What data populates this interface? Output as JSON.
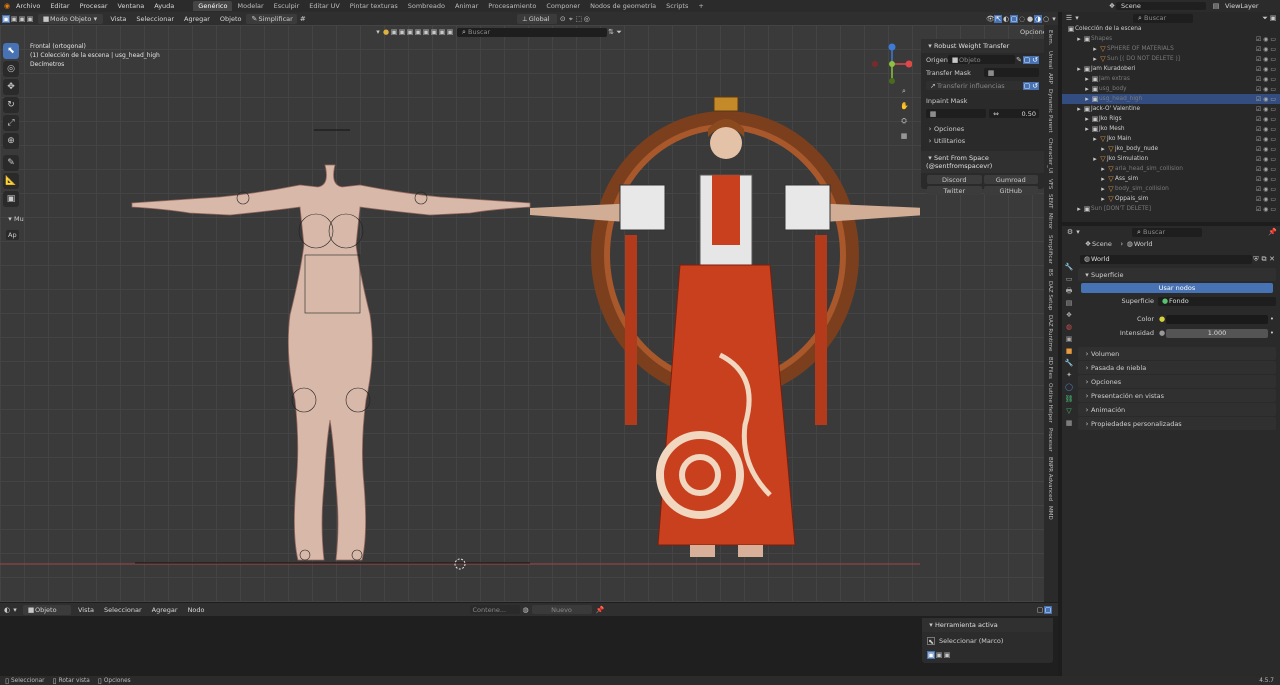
{
  "topbar": {
    "menus": [
      "Archivo",
      "Editar",
      "Procesar",
      "Ventana",
      "Ayuda"
    ],
    "workspaces": [
      "Genérico",
      "Modelar",
      "Esculpir",
      "Editar UV",
      "Pintar texturas",
      "Sombreado",
      "Animar",
      "Procesamiento",
      "Componer",
      "Nodos de geometría",
      "Scripts"
    ],
    "active_workspace": "Genérico",
    "scene": "Scene",
    "view_layer": "ViewLayer"
  },
  "viewport_header": {
    "mode": "Modo Objeto",
    "menus": [
      "Vista",
      "Seleccionar",
      "Agregar",
      "Objeto"
    ],
    "simplify": "Simplificar",
    "transform": "Global",
    "search_placeholder": "Buscar",
    "options": "Opciones"
  },
  "viewport_info": {
    "view": "Frontal (ortogonal)",
    "collection": "(1) Colección de la escena | usg_head_high",
    "units": "Decímetros"
  },
  "left_panel": {
    "mu": "Mu",
    "ap": "Ap"
  },
  "npanel": {
    "title": "Robust Weight Transfer",
    "origin_label": "Origen:",
    "origin_placeholder": "Objeto",
    "transfer_mask": "Transfer Mask",
    "transfer_button": "Transferir influencias",
    "inpaint_mask": "Inpaint Mask",
    "inpaint_value": "0.50",
    "options": "Opciones",
    "utilities": "Utilitarios",
    "sent_title": "Sent From Space (@sentfromspacevr)",
    "links": [
      "Discord",
      "Gumroad",
      "Twitter",
      "GitHub"
    ]
  },
  "vtabs": [
    "Elem.",
    "Unreal",
    "ARP",
    "Dynamic Parent",
    "Character_UI",
    "VFS",
    "SENT",
    "Mirror",
    "Simplificar",
    "BS",
    "DAZ Setup",
    "DAZ Runtime",
    "BD Files",
    "Outline Helper",
    "Procesar",
    "BNPR Advanced",
    "MMD"
  ],
  "outliner": {
    "search_placeholder": "Buscar",
    "root": "Colección de la escena",
    "rows": [
      {
        "label": "Shapes",
        "indent": 1,
        "dim": true
      },
      {
        "label": "SPHERE OF MATERIALS",
        "indent": 3,
        "dim": true
      },
      {
        "label": "Sun [( DO NOT DELETE )]",
        "indent": 3,
        "dim": true
      },
      {
        "label": "Jam Kuradoberi",
        "indent": 1,
        "dim": false
      },
      {
        "label": "Jam extras",
        "indent": 2,
        "dim": true
      },
      {
        "label": "usg_body",
        "indent": 2,
        "dim": true
      },
      {
        "label": "usg_head_high",
        "indent": 2,
        "dim": true,
        "selected": true
      },
      {
        "label": "Jack-O' Valentine",
        "indent": 1,
        "dim": false
      },
      {
        "label": "Jko Rigs",
        "indent": 2,
        "dim": false
      },
      {
        "label": "Jko Mesh",
        "indent": 2,
        "dim": false
      },
      {
        "label": "Jko Main",
        "indent": 3,
        "dim": false
      },
      {
        "label": "jko_body_nude",
        "indent": 4,
        "dim": false
      },
      {
        "label": "Jko Simulation",
        "indent": 3,
        "dim": false
      },
      {
        "label": "aria_head_sim_collision",
        "indent": 4,
        "dim": true
      },
      {
        "label": "Ass_sim",
        "indent": 4,
        "dim": false
      },
      {
        "label": "body_sim_collision",
        "indent": 4,
        "dim": true
      },
      {
        "label": "Oppais_sim",
        "indent": 4,
        "dim": false
      },
      {
        "label": "Sun [DON'T DELETE]",
        "indent": 1,
        "dim": true
      }
    ]
  },
  "properties": {
    "search_placeholder": "Buscar",
    "breadcrumb_scene": "Scene",
    "breadcrumb_world": "World",
    "world_name": "World",
    "surface_section": "Superficie",
    "use_nodes": "Usar nodos",
    "surface_label": "Superficie",
    "surface_value": "Fondo",
    "color_label": "Color",
    "strength_label": "Intensidad",
    "strength_value": "1.000",
    "sections": [
      "Volumen",
      "Pasada de niebla",
      "Opciones",
      "Presentación en vistas",
      "Animación",
      "Propiedades personalizadas"
    ]
  },
  "bottom_header": {
    "mode": "Objeto",
    "menus": [
      "Vista",
      "Seleccionar",
      "Agregar",
      "Nodo"
    ],
    "slot": "Contene...",
    "new_button": "Nuevo"
  },
  "active_tool": {
    "title": "Herramienta activa",
    "tool": "Seleccionar (Marco)"
  },
  "status_bar": {
    "items": [
      "Seleccionar",
      "Rotar vista",
      "Opciones"
    ],
    "version": "4.5.7"
  },
  "colors": {
    "accent": "#4772b3",
    "gizmo_x": "#e04747",
    "gizmo_y": "#8ec23c",
    "gizmo_z": "#3d7bd6"
  }
}
